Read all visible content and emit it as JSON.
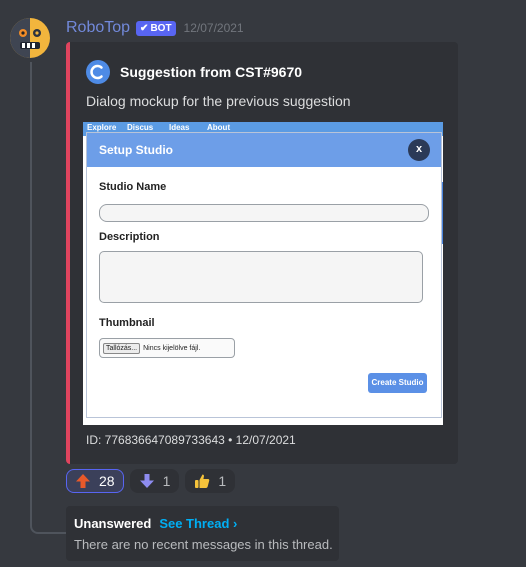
{
  "message": {
    "username": "RoboTop",
    "bot_tag": "BOT",
    "timestamp": "12/07/2021"
  },
  "embed": {
    "author": "Suggestion from CST#9670",
    "description": "Dialog mockup for the previous suggestion",
    "footer": "ID: 776836647089733643 • 12/07/2021",
    "accent_color": "#e0445e"
  },
  "mockup": {
    "nav": [
      "Explore",
      "Discus",
      "Ideas",
      "About"
    ],
    "dialog_title": "Setup Studio",
    "close_label": "x",
    "studio_name_label": "Studio Name",
    "description_label": "Description",
    "thumbnail_label": "Thumbnail",
    "file_button": "Tallózás...",
    "file_none": "Nincs kijelölve fájl.",
    "create_button": "Create Studio"
  },
  "reactions": [
    {
      "emoji": "arrow-up-icon",
      "count": "28",
      "active": true
    },
    {
      "emoji": "arrow-down-icon",
      "count": "1",
      "active": false
    },
    {
      "emoji": "thumbs-up-icon",
      "count": "1",
      "active": false
    }
  ],
  "thread": {
    "status": "Unanswered",
    "link": "See Thread ›",
    "message": "There are no recent messages in this thread."
  }
}
